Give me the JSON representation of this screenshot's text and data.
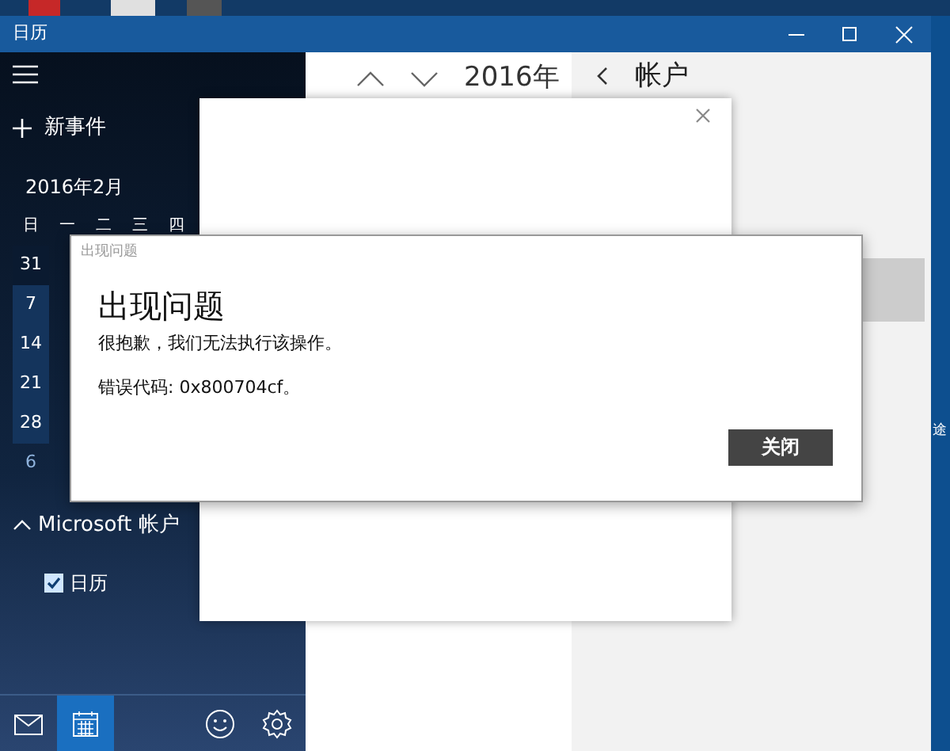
{
  "desktop": {
    "icon_label": "途"
  },
  "window": {
    "title": "日历"
  },
  "sidebar": {
    "new_event": "新事件",
    "month": "2016年2月",
    "weekdays": [
      "日",
      "一",
      "二",
      "三",
      "四"
    ],
    "dates": [
      {
        "label": "31",
        "kind": "prev"
      },
      {
        "label": "7",
        "kind": "month"
      },
      {
        "label": "14",
        "kind": "month"
      },
      {
        "label": "21",
        "kind": "month"
      },
      {
        "label": "28",
        "kind": "month"
      },
      {
        "label": "6",
        "kind": "next"
      }
    ],
    "account": {
      "label": "Microsoft 帐户",
      "expanded": true
    },
    "calendars": [
      {
        "label": "日历",
        "checked": true
      }
    ],
    "bottom_tabs": [
      {
        "kind": "mail",
        "selected": false
      },
      {
        "kind": "calendar",
        "selected": true
      },
      {
        "kind": "feedback",
        "selected": false
      },
      {
        "kind": "settings",
        "selected": false
      }
    ]
  },
  "main": {
    "year": "2016年"
  },
  "accounts_panel": {
    "title": "帐户"
  },
  "error_dialog": {
    "caption": "出现问题",
    "heading": "出现问题",
    "message": "很抱歉，我们无法执行该操作。",
    "error_code": "错误代码: 0x800704cf。",
    "button": "关闭"
  }
}
